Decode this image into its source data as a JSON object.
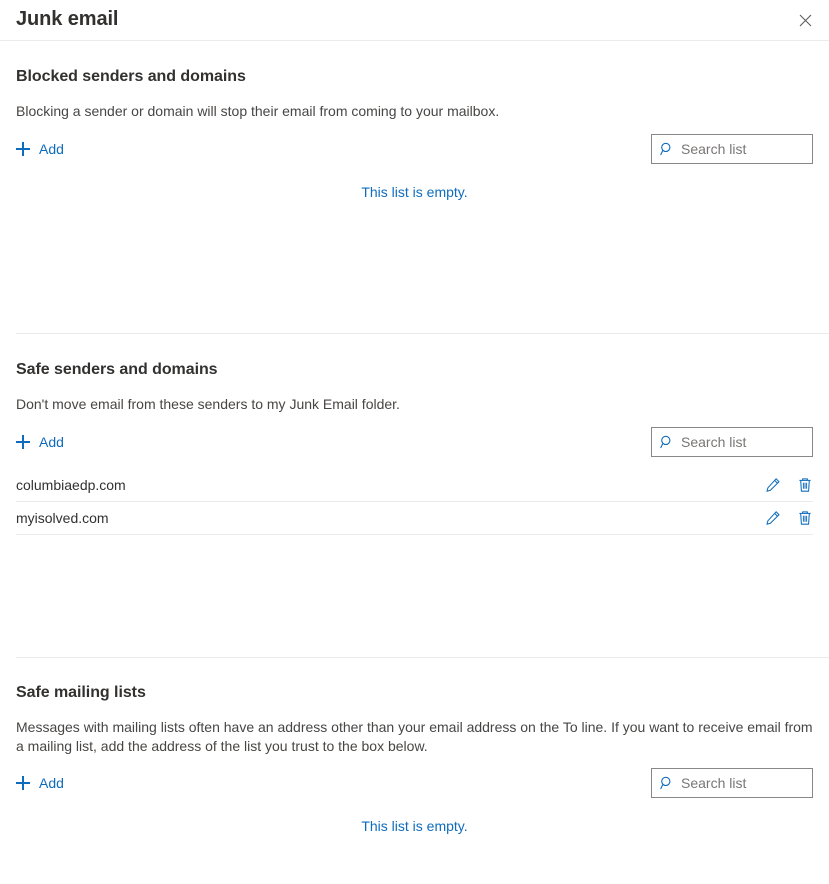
{
  "header": {
    "title": "Junk email",
    "close_icon": "close-icon"
  },
  "sections": [
    {
      "id": "blocked-senders",
      "heading": "Blocked senders and domains",
      "description": "Blocking a sender or domain will stop their email from coming to your mailbox.",
      "add_label": "Add",
      "add_icon": "plus-icon",
      "search": {
        "icon": "search-icon",
        "placeholder": "Search list",
        "value": ""
      },
      "empty_message": "This list is empty.",
      "items": []
    },
    {
      "id": "safe-senders",
      "heading": "Safe senders and domains",
      "description": "Don't move email from these senders to my Junk Email folder.",
      "add_label": "Add",
      "add_icon": "plus-icon",
      "search": {
        "icon": "search-icon",
        "placeholder": "Search list",
        "value": ""
      },
      "empty_message": "",
      "items": [
        {
          "label": "columbiaedp.com",
          "edit_icon": "pencil-icon",
          "delete_icon": "trash-icon"
        },
        {
          "label": "myisolved.com",
          "edit_icon": "pencil-icon",
          "delete_icon": "trash-icon"
        }
      ]
    },
    {
      "id": "safe-mailing-lists",
      "heading": "Safe mailing lists",
      "description": "Messages with mailing lists often have an address other than your email address on the To line. If you want to receive email from a mailing list, add the address of the list you trust to the box below.",
      "add_label": "Add",
      "add_icon": "plus-icon",
      "search": {
        "icon": "search-icon",
        "placeholder": "Search list",
        "value": ""
      },
      "empty_message": "This list is empty.",
      "items": []
    }
  ],
  "colors": {
    "accent": "#0f6cbd",
    "text_primary": "#323130",
    "text_secondary": "#484644",
    "divider": "#edebe9",
    "input_border": "#8a8886",
    "background": "#ffffff"
  }
}
